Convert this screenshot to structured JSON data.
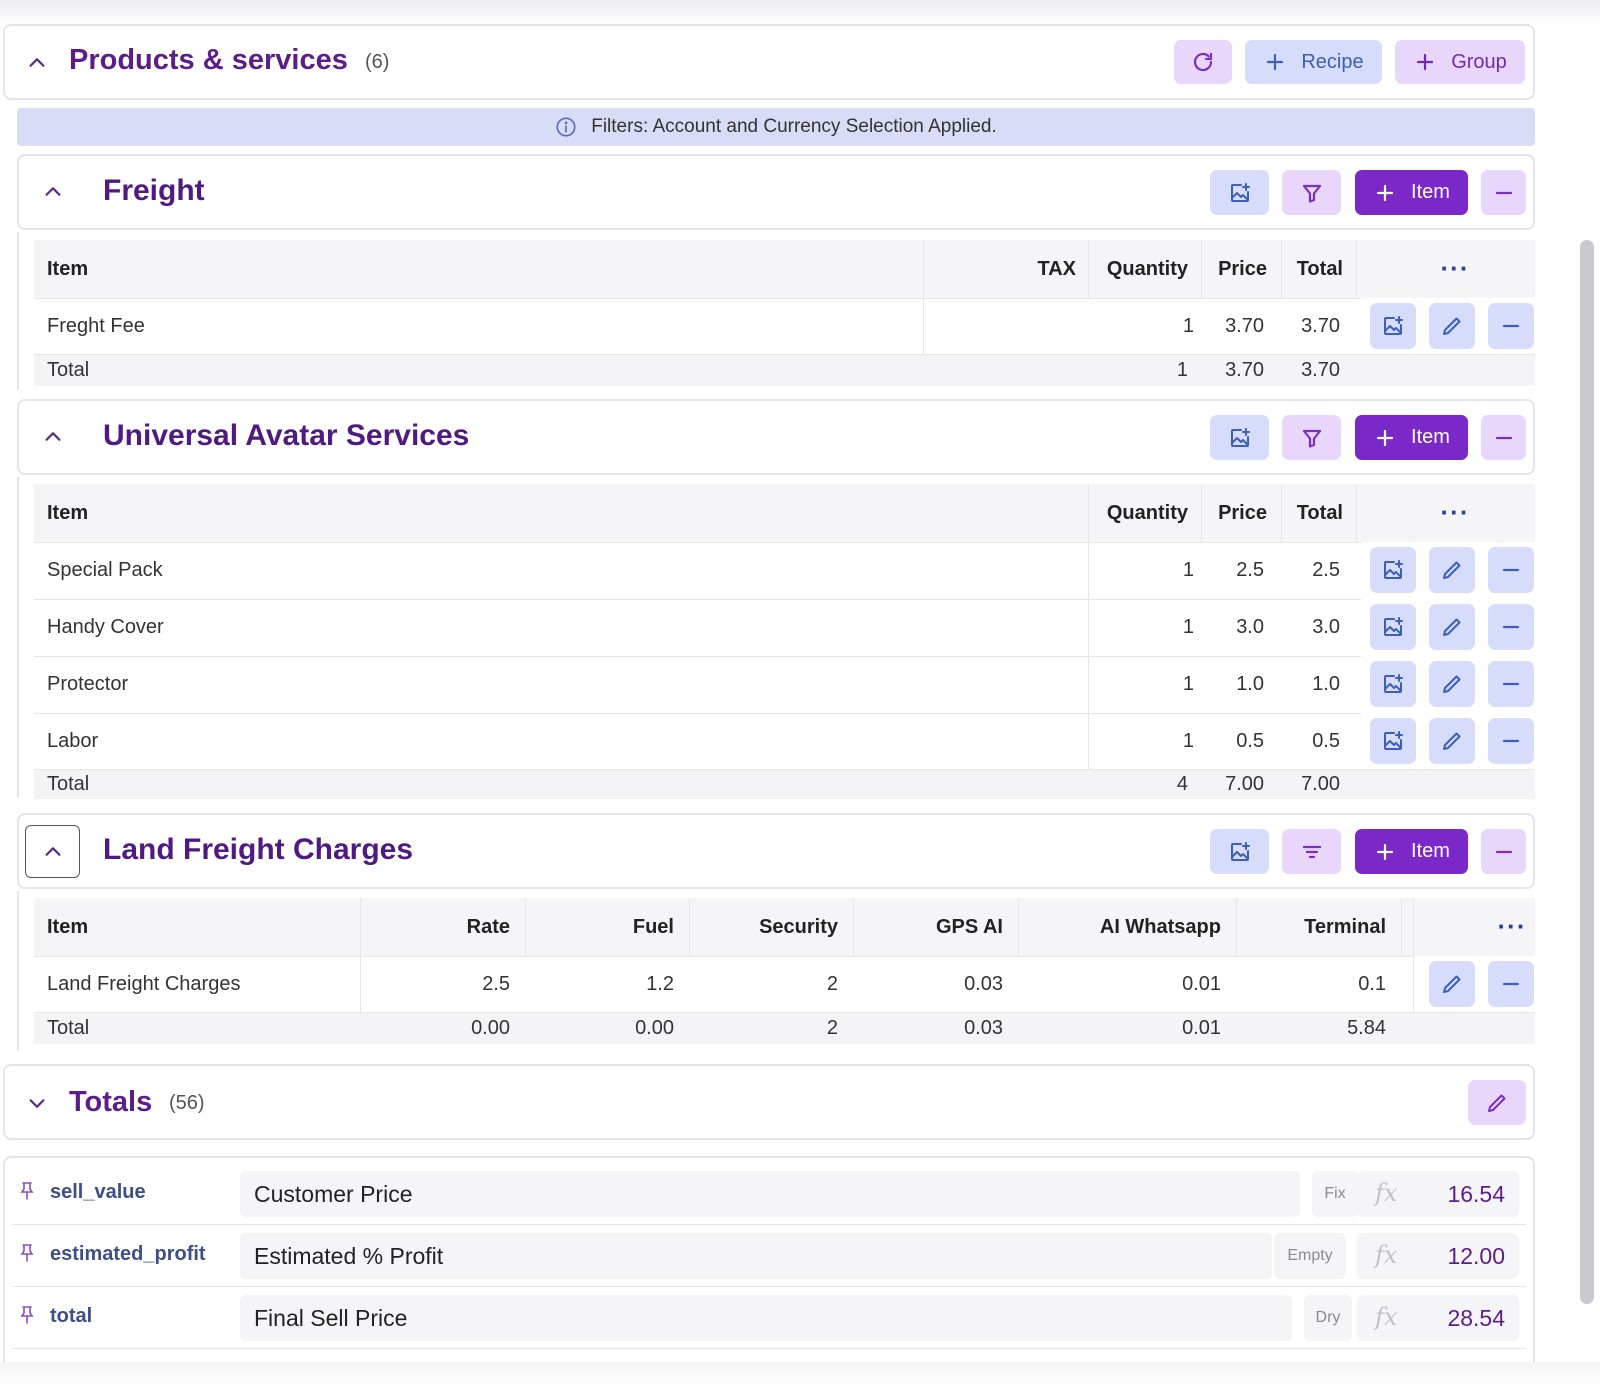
{
  "products": {
    "title": "Products & services",
    "count": "(6)",
    "buttons": {
      "recipe": "Recipe",
      "group": "Group"
    }
  },
  "banner": {
    "text": "Filters: Account and Currency Selection Applied."
  },
  "item_button": "Item",
  "more_glyph": "···",
  "freight": {
    "title": "Freight",
    "headers": {
      "item": "Item",
      "tax": "TAX",
      "quantity": "Quantity",
      "price": "Price",
      "total": "Total"
    },
    "rows": [
      {
        "item": "Freght Fee",
        "tax": "",
        "quantity": "1",
        "price": "3.70",
        "total": "3.70"
      }
    ],
    "total_row": {
      "label": "Total",
      "quantity": "1",
      "price": "3.70",
      "total": "3.70"
    }
  },
  "universal": {
    "title": "Universal Avatar Services",
    "headers": {
      "item": "Item",
      "quantity": "Quantity",
      "price": "Price",
      "total": "Total"
    },
    "rows": [
      {
        "item": "Special Pack",
        "quantity": "1",
        "price": "2.5",
        "total": "2.5"
      },
      {
        "item": "Handy Cover",
        "quantity": "1",
        "price": "3.0",
        "total": "3.0"
      },
      {
        "item": "Protector",
        "quantity": "1",
        "price": "1.0",
        "total": "1.0"
      },
      {
        "item": "Labor",
        "quantity": "1",
        "price": "0.5",
        "total": "0.5"
      }
    ],
    "total_row": {
      "label": "Total",
      "quantity": "4",
      "price": "7.00",
      "total": "7.00"
    }
  },
  "land": {
    "title": "Land Freight Charges",
    "headers": {
      "item": "Item",
      "rate": "Rate",
      "fuel": "Fuel",
      "security": "Security",
      "gps": "GPS AI",
      "whatsapp": "AI Whatsapp",
      "terminal": "Terminal"
    },
    "rows": [
      {
        "item": "Land Freight Charges",
        "rate": "2.5",
        "fuel": "1.2",
        "security": "2",
        "gps": "0.03",
        "whatsapp": "0.01",
        "terminal": "0.1"
      }
    ],
    "total_row": {
      "label": "Total",
      "rate": "0.00",
      "fuel": "0.00",
      "security": "2",
      "gps": "0.03",
      "whatsapp": "0.01",
      "terminal": "5.84"
    }
  },
  "totals": {
    "title": "Totals",
    "count": "(56)",
    "rows": [
      {
        "key": "sell_value",
        "label": "Customer Price",
        "mode": "Fix",
        "value": "16.54"
      },
      {
        "key": "estimated_profit",
        "label": "Estimated % Profit",
        "mode": "Empty",
        "value": "12.00"
      },
      {
        "key": "total",
        "label": "Final Sell Price",
        "mode": "Dry",
        "value": "28.54"
      }
    ]
  },
  "icons": {
    "collapse": "chevron-up-icon",
    "expand": "chevron-down-icon",
    "refresh": "refresh-icon",
    "add": "plus-icon",
    "image_add": "image-add-icon",
    "filter": "filter-icon",
    "sort_filter": "filter-lines-icon",
    "remove": "minus-icon",
    "edit": "pencil-icon",
    "info": "info-icon",
    "pin": "pin-icon",
    "formula": "fx-icon"
  },
  "colors": {
    "accent": "#7b28c8",
    "heading": "#5c1d8a",
    "lavender": "#e9d6fb",
    "blue_tint": "#d6dcf9",
    "banner": "#d9dcf7"
  }
}
